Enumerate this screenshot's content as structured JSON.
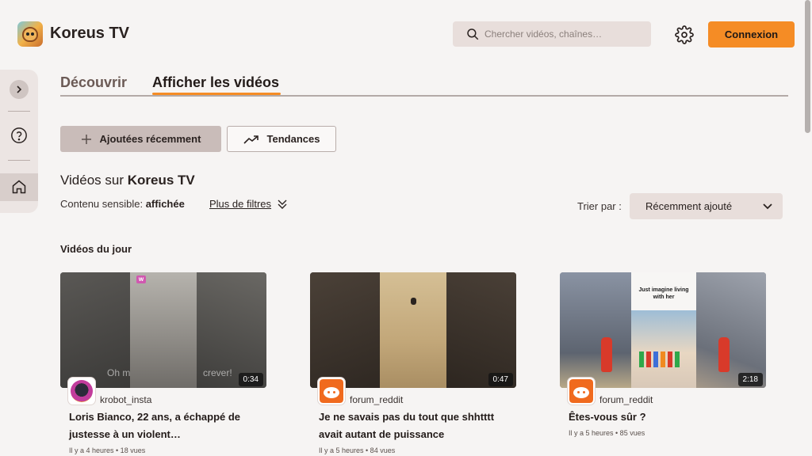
{
  "header": {
    "brand": "Koreus TV",
    "search_placeholder": "Chercher vidéos, chaînes…",
    "login_label": "Connexion",
    "accent": "#f58c25"
  },
  "sidebar": {
    "icons": [
      "chevron-right-icon",
      "help-icon",
      "home-icon"
    ]
  },
  "tabs": [
    {
      "label": "Découvrir",
      "active": false
    },
    {
      "label": "Afficher les vidéos",
      "active": true
    }
  ],
  "chips": {
    "recent": "Ajoutées récemment",
    "trending": "Tendances"
  },
  "videos_header": {
    "prefix": "Vidéos sur",
    "channel": "Koreus TV",
    "sensitive_label": "Contenu sensible:",
    "sensitive_value": "affichée",
    "more_filters": "Plus de filtres",
    "sort_label": "Trier par :",
    "sort_value": "Récemment ajouté"
  },
  "section_title": "Vidéos du jour",
  "videos": [
    {
      "channel": "krobot_insta",
      "title": "Loris Bianco, 22 ans, a échappé de justesse à un violent…",
      "duration": "0:34",
      "meta": "Il y a 4 heures • 18 vues",
      "overlay_text": "Oh m",
      "overlay_text2": "crever!"
    },
    {
      "channel": "forum_reddit",
      "title": "Je ne savais pas du tout que shhtttt avait autant de puissance",
      "duration": "0:47",
      "meta": "Il y a 5 heures • 84 vues"
    },
    {
      "channel": "forum_reddit",
      "title": "Êtes-vous sûr ?",
      "duration": "2:18",
      "meta": "Il y a 5 heures • 85 vues",
      "overlay_text": "Just imagine living with her"
    }
  ]
}
